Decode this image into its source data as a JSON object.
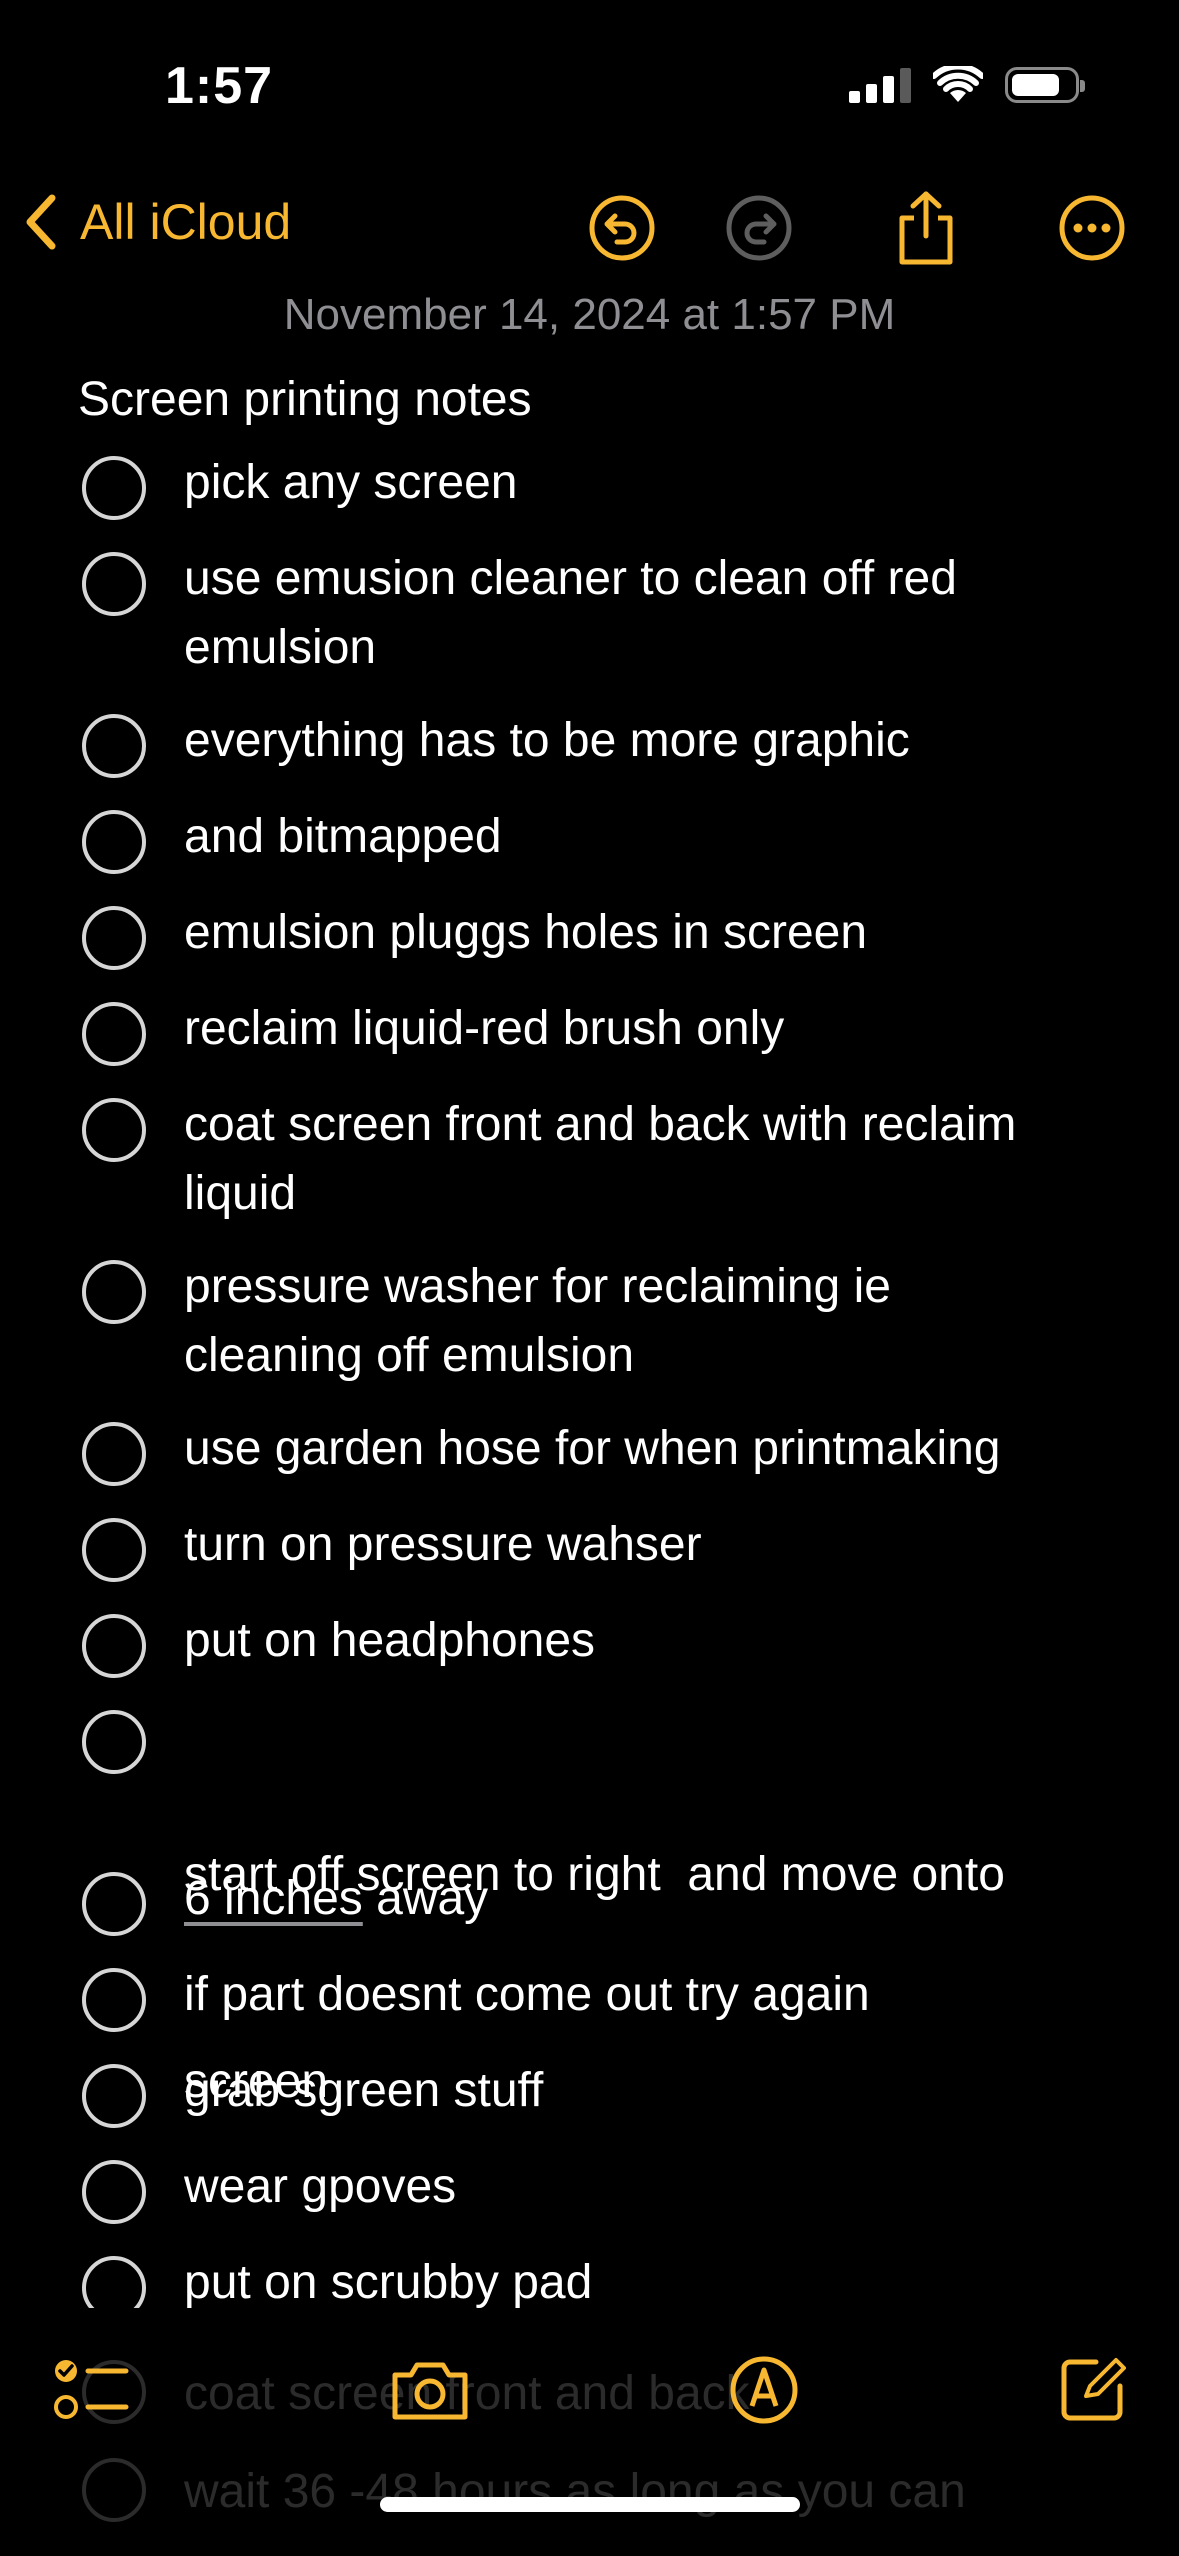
{
  "status_bar": {
    "time": "1:57"
  },
  "nav": {
    "back_label": "All iCloud",
    "accent_color": "#f7b731",
    "icons": [
      "undo-icon",
      "redo-icon",
      "share-icon",
      "more-icon"
    ]
  },
  "note": {
    "date": "November 14, 2024 at 1:57 PM",
    "title": "Screen printing notes",
    "items": [
      {
        "lines": [
          "pick any screen"
        ]
      },
      {
        "lines": [
          "use emusion cleaner to clean off red",
          "emulsion"
        ]
      },
      {
        "lines": [
          "everything has to be more graphic"
        ]
      },
      {
        "lines": [
          "and bitmapped"
        ]
      },
      {
        "lines": [
          "emulsion pluggs holes in screen"
        ]
      },
      {
        "lines": [
          "reclaim liquid-red brush only"
        ]
      },
      {
        "lines": [
          "coat screen front and back with reclaim",
          "liquid"
        ]
      },
      {
        "lines": [
          "pressure washer for reclaiming ie",
          "cleaning off emulsion"
        ]
      },
      {
        "lines": [
          "use garden hose for when printmaking"
        ]
      },
      {
        "lines": [
          "turn on pressure wahser"
        ]
      },
      {
        "lines": [
          "put on headphones"
        ]
      },
      {
        "lines": [
          "start off screen to right  and move onto",
          "screen"
        ]
      },
      {
        "underlined": "6 inches",
        "rest": " away"
      },
      {
        "lines": [
          "if part doesnt come out try again"
        ]
      },
      {
        "lines": [
          "grab sgreen stuff"
        ]
      },
      {
        "lines": [
          "wear gpoves"
        ]
      },
      {
        "lines": [
          "put on scrubby pad"
        ]
      }
    ],
    "faded_items": [
      "coat screen front and back",
      "wait 36 -48 hours as long as you can"
    ]
  },
  "toolbar": {
    "icons": [
      "checklist-icon",
      "camera-icon",
      "markup-icon",
      "compose-icon"
    ]
  }
}
